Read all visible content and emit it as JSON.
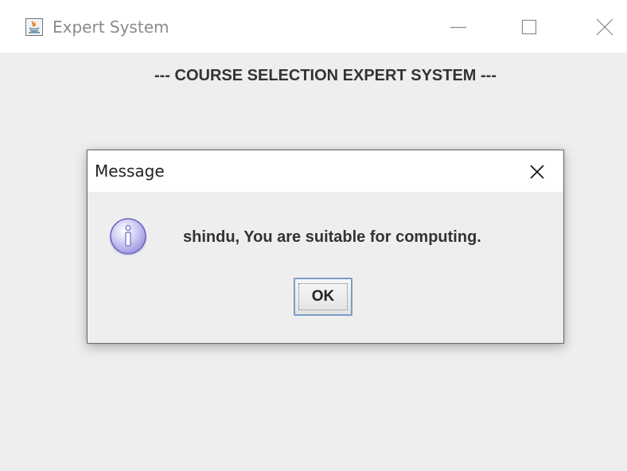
{
  "window": {
    "title": "Expert System",
    "icon": "java-app-icon"
  },
  "window_controls": {
    "minimize_icon": "minimize-icon",
    "maximize_icon": "maximize-icon",
    "close_icon": "close-icon"
  },
  "main": {
    "heading": "--- COURSE SELECTION EXPERT SYSTEM ---"
  },
  "dialog": {
    "title": "Message",
    "close_icon": "close-icon",
    "icon": "info-icon",
    "message": "shindu, You are suitable for computing.",
    "ok_label": "OK"
  },
  "colors": {
    "window_background": "#eeeeee",
    "titlebar_background": "#ffffff",
    "button_border": "#7a9cc6",
    "info_icon_fill": "#c9c6f2"
  }
}
